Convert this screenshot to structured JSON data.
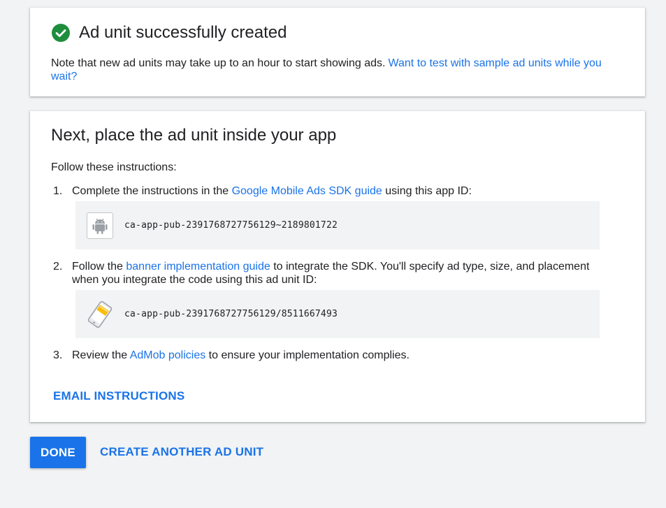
{
  "success": {
    "title": "Ad unit successfully created",
    "note": "Note that new ad units may take up to an hour to start showing ads.",
    "test_link": "Want to test with sample ad units while you wait?",
    "icon": "check-circle-icon",
    "icon_color": "#1e8e3e"
  },
  "next": {
    "title": "Next, place the ad unit inside your app",
    "follow": "Follow these instructions:",
    "steps": [
      {
        "num": "1.",
        "before": "Complete the instructions in the",
        "link": "Google Mobile Ads SDK guide",
        "after": "using this app ID:",
        "code": "ca-app-pub-2391768727756129~2189801722",
        "icon": "android-icon"
      },
      {
        "num": "2.",
        "before": "Follow the",
        "link": "banner implementation guide",
        "after": "to integrate the SDK. You'll specify ad type, size, and placement when you integrate the code using this ad unit ID:",
        "code": "ca-app-pub-2391768727756129/8511667493",
        "icon": "banner-ad-unit-icon"
      },
      {
        "num": "3.",
        "before": "Review the",
        "link": "AdMob policies",
        "after": "to ensure your implementation complies."
      }
    ],
    "email_button": "EMAIL INSTRUCTIONS"
  },
  "actions": {
    "done": "DONE",
    "create_another": "CREATE ANOTHER AD UNIT"
  },
  "colors": {
    "accent": "#1a73e8",
    "success": "#1e8e3e",
    "background": "#f1f3f4"
  }
}
